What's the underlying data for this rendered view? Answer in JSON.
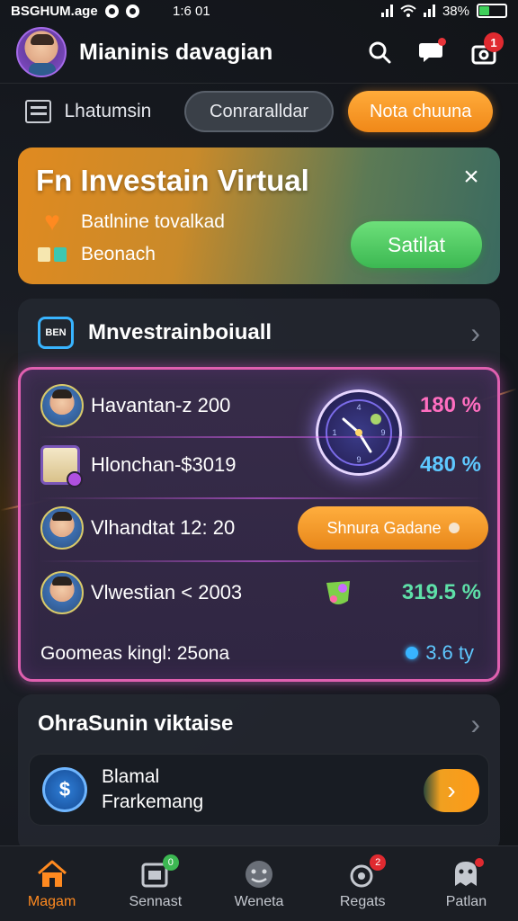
{
  "status": {
    "left": "BSGHUM.age",
    "time": "1:6 01",
    "battery": "38%",
    "battery_level": 0.38
  },
  "header": {
    "title": "Mianinis davagian",
    "message_badge": "",
    "bag_badge": "1"
  },
  "tabs": {
    "label": "Lhatumsin",
    "pill1": "Conraralldar",
    "pill2": "Nota chuuna"
  },
  "promo": {
    "title": "Fn Investain Virtual",
    "line1": "Batlnine tovalkad",
    "line2": "Beonach",
    "button": "Satilat",
    "close": "×"
  },
  "investments": {
    "icon_text": "BEN",
    "title": "Mnvestrainboiuall",
    "items": [
      {
        "name": "Havantan-z 200",
        "pct": "180 %",
        "pct_color": "#ff6ec0"
      },
      {
        "name": "Hlonchan-$3019",
        "pct": "480 %",
        "pct_color": "#5ec8ff"
      },
      {
        "name": "Vlhandtat 12: 20",
        "action": "Shnura Gadane"
      },
      {
        "name": "Vlwestian < 2003",
        "pct": "319.5 %",
        "pct_color": "#5ee0a8"
      }
    ],
    "total_label": "Goomeas kingl: 25ona",
    "total_value": "3.6 ty"
  },
  "finance": {
    "title": "OhraSunin viktaise",
    "coin": "$",
    "line1": "Blamal",
    "line2": "Frarkemang",
    "go": "›"
  },
  "nav": {
    "items": [
      {
        "label": "Magam"
      },
      {
        "label": "Sennast"
      },
      {
        "label": "Weneta"
      },
      {
        "label": "Regats"
      },
      {
        "label": "Patlan"
      }
    ]
  },
  "colors": {
    "accent_orange": "#ff8a20",
    "accent_pink": "#e060b0",
    "accent_blue": "#38b4ff",
    "accent_green": "#3cb852"
  }
}
